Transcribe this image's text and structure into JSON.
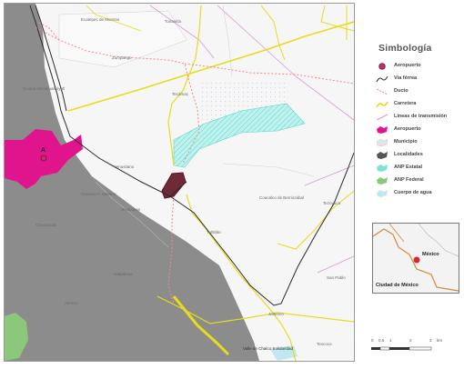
{
  "legend": {
    "title": "Simbología",
    "items": [
      {
        "label": "Aeropuerto",
        "icon": "airport-point-icon",
        "color": "#c0306a"
      },
      {
        "label": "Vía férrea",
        "icon": "railway-icon",
        "color": "#333333"
      },
      {
        "label": "Ducto",
        "icon": "pipeline-icon",
        "color": "#f08a8a"
      },
      {
        "label": "Carretera",
        "icon": "highway-icon",
        "color": "#e6dc1e"
      },
      {
        "label": "Líneas de transmisión",
        "icon": "transmission-line-icon",
        "color": "#d49ad8"
      },
      {
        "label": "Aeropuerto",
        "icon": "airport-area-icon",
        "color": "#e0148c"
      },
      {
        "label": "Municipio",
        "icon": "municipality-icon",
        "color": "#e4e4e4"
      },
      {
        "label": "Localidades",
        "icon": "localities-icon",
        "color": "#555555"
      },
      {
        "label": "ANP Estatal",
        "icon": "anp-estatal-icon",
        "color": "#7fe0d8"
      },
      {
        "label": "ANP Federal",
        "icon": "anp-federal-icon",
        "color": "#8cc87a"
      },
      {
        "label": "Cuerpo de agua",
        "icon": "water-body-icon",
        "color": "#bfe8f0"
      }
    ]
  },
  "map": {
    "places": {
      "p1": "Ecatepec de Morelos",
      "p2": "Tonanitla",
      "p3": "Ciudad Nezahualcóyotl",
      "p4": "Tecámac",
      "p5": "Zumpango",
      "p6": "Nextlalpan",
      "p7": "Coacalco de Berriozábal",
      "p8": "Chiconcuac",
      "p9": "Atenco",
      "p10": "Tezoyuca",
      "p11": "Jaltenco",
      "p12": "Gustavo A. Madero",
      "p13": "Texcoco",
      "p14": "San Pablo",
      "p15": "Venustiano",
      "p16": "Valle de Chalco Solidaridad",
      "p17": "Ixtapaluca",
      "p18": "Tultitlán"
    },
    "airport_marker": "A",
    "colors": {
      "municipality_fill": "#f4f4f4",
      "urban_gray": "#8c8c8c",
      "airport_magenta": "#e0148c",
      "anp_cyan": "#7fe0d8",
      "anp_green": "#8cc87a",
      "road_yellow": "#e6dc1e",
      "rail_black": "#2a2a2a",
      "pipeline_red": "#f08a8a",
      "transmission_purple": "#d49ad8"
    }
  },
  "inset": {
    "label_mexico": "México",
    "label_cdmx": "Ciudad de México"
  },
  "scale": {
    "ticks": [
      "0",
      "0.5",
      "1",
      "2",
      "3"
    ],
    "unit": "km"
  }
}
